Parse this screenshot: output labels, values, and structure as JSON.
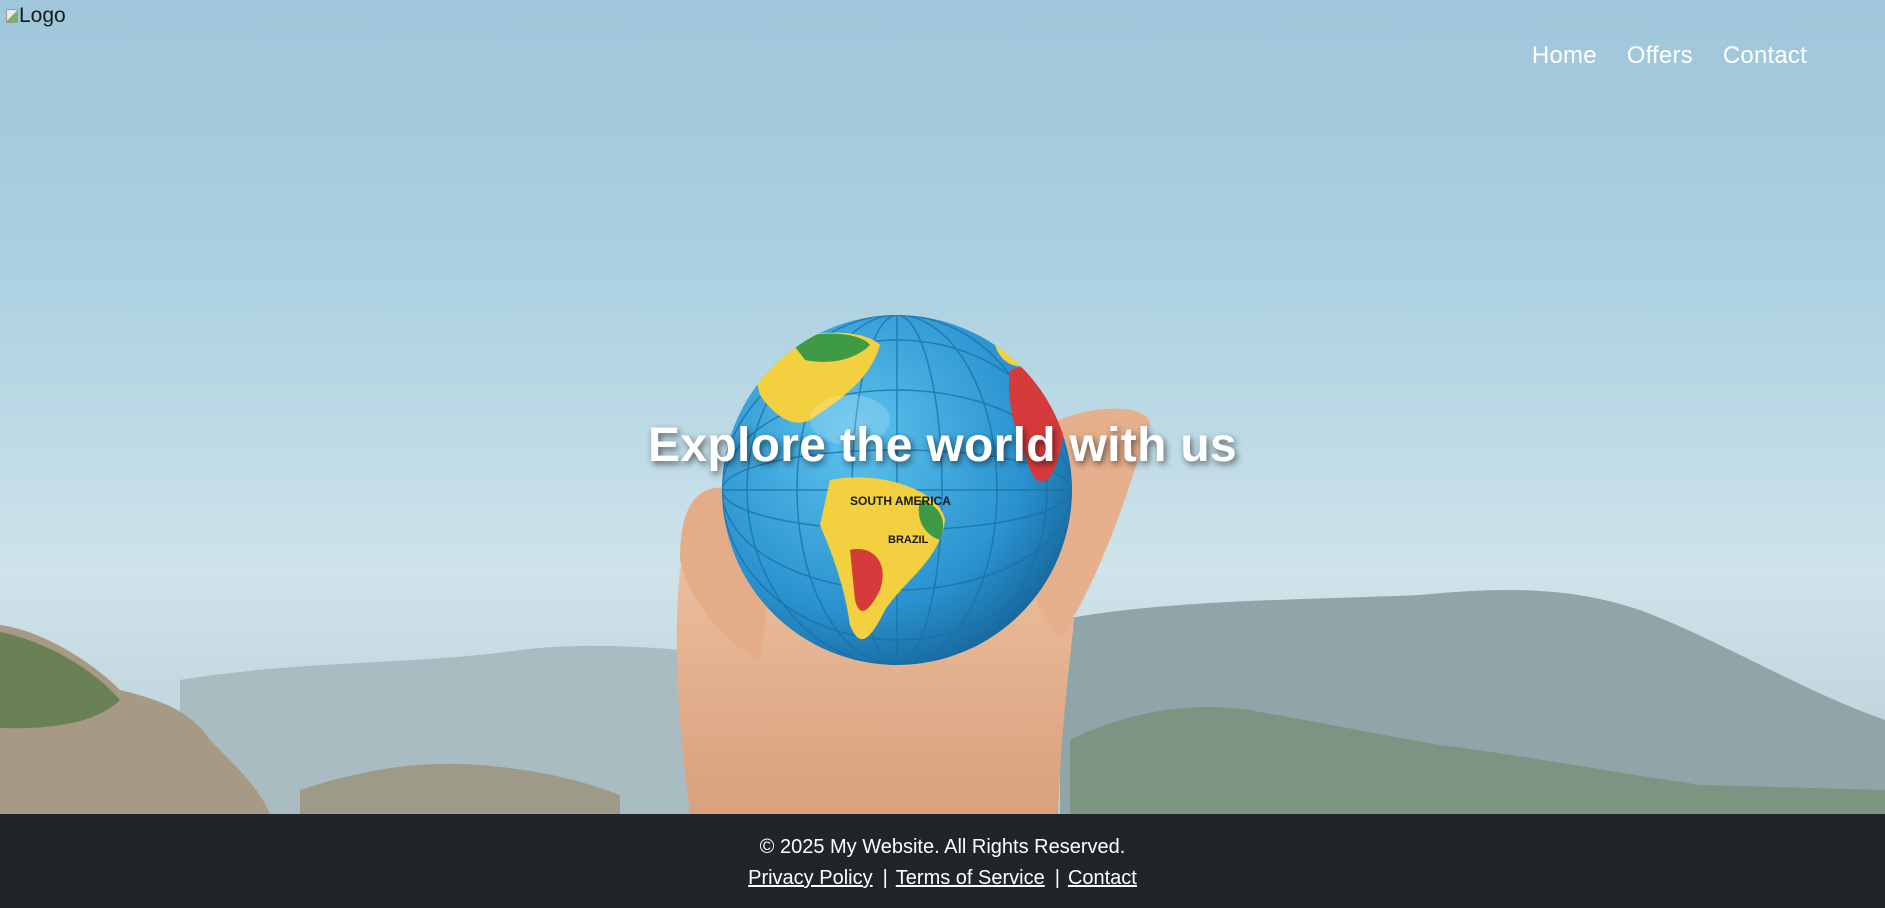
{
  "header": {
    "logo_alt": "Logo",
    "nav": [
      {
        "label": "Home"
      },
      {
        "label": "Offers"
      },
      {
        "label": "Contact"
      }
    ]
  },
  "hero": {
    "title": "Explore the world with us",
    "globe_labels": [
      "SOUTH AMERICA",
      "BRAZIL"
    ],
    "colors": {
      "sky": "#a9cfe0",
      "ocean": "#2a93cf",
      "skin": "#e8b896",
      "mountain": "#8ea39a"
    }
  },
  "footer": {
    "copyright": "© 2025 My Website. All Rights Reserved.",
    "links": [
      {
        "label": "Privacy Policy"
      },
      {
        "label": "Terms of Service"
      },
      {
        "label": "Contact"
      }
    ],
    "separator": "|",
    "background": "#212529"
  }
}
